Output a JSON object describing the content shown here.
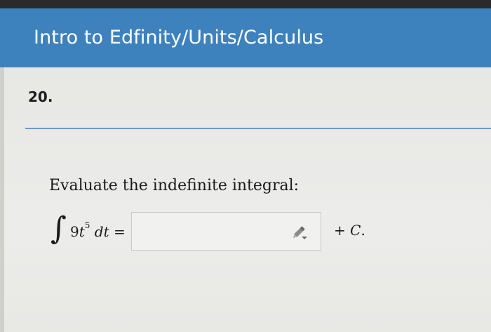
{
  "header": {
    "title": "Intro to Edfinity/Units/Calculus"
  },
  "question": {
    "number": "20.",
    "prompt": "Evaluate the indefinite integral:",
    "integral_sign": "∫",
    "coefficient": "9",
    "variable": "t",
    "exponent": "5",
    "differential": "dt",
    "equals": "=",
    "answer_value": "",
    "suffix_plus": "+ ",
    "suffix_constant": "C",
    "suffix_period": "."
  },
  "icons": {
    "answer_tool": "pencil-icon"
  },
  "colors": {
    "header_bg": "#3e82bd",
    "divider": "#6e9ac7",
    "page_bg": "#e9e9e6"
  }
}
